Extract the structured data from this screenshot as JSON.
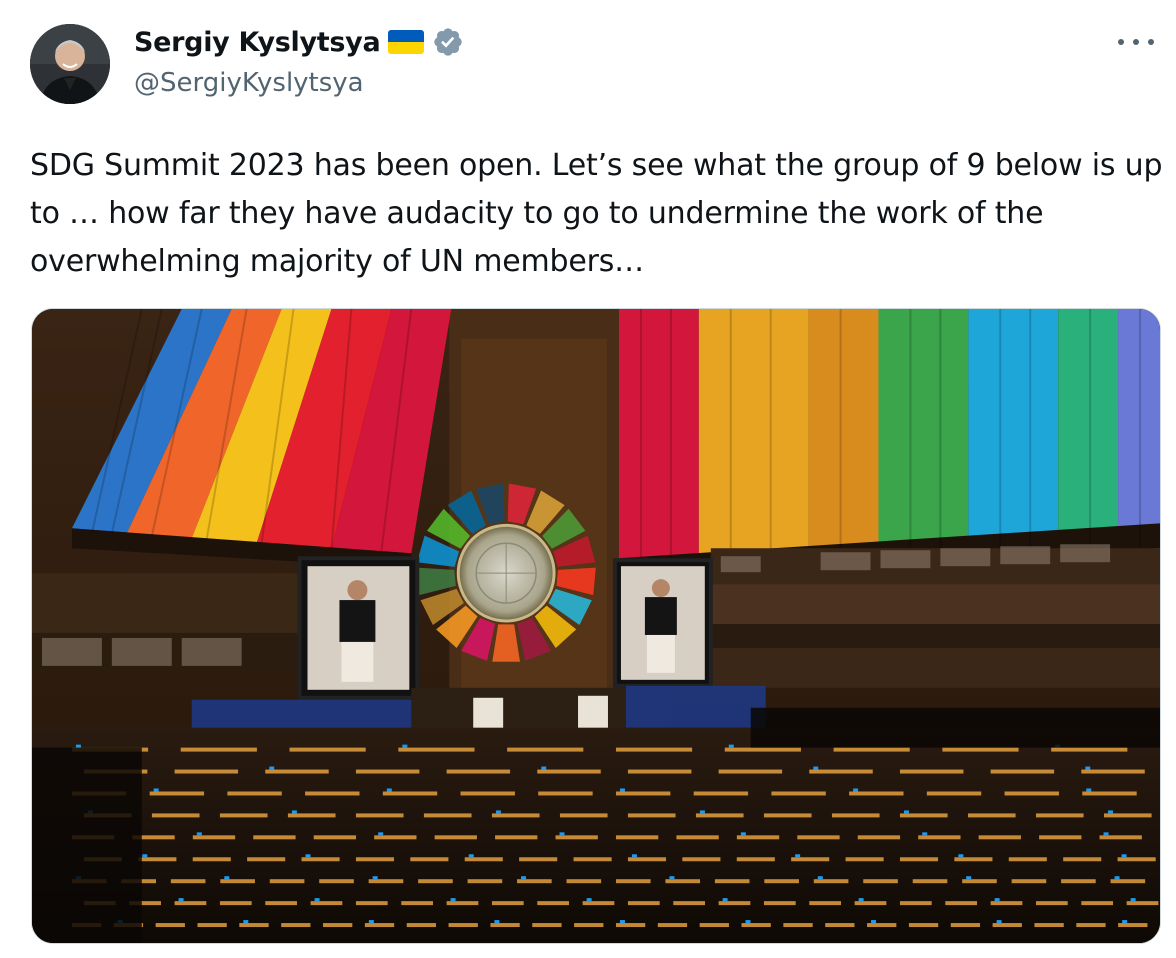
{
  "author": {
    "name": "Sergiy Kyslytsya",
    "handle": "@SergiyKyslytsya",
    "flag_icon": "ukraine-flag-icon",
    "verified_icon": "verified-badge-icon",
    "verified_color": "#829aab"
  },
  "menu": {
    "more_icon": "more-options-icon"
  },
  "post": {
    "text": "SDG Summit 2023 has been open. Let’s see what the group of 9 below is up to … how far they have audacity to go to undermine the work of the overwhelming majority of UN members…"
  },
  "media": {
    "image_label": "",
    "colors": {
      "accent_blue": "#1d9bf0",
      "stage_glow": "#ffb347",
      "sdg_colors": [
        "#e5243b",
        "#dda63a",
        "#4c9f38",
        "#c5192d",
        "#ff3a21",
        "#26bde2",
        "#fcc30b",
        "#a21942",
        "#fd6925",
        "#dd1367",
        "#fd9d24",
        "#bf8b2e",
        "#3f7e44",
        "#0a97d9",
        "#56c02b",
        "#00689d",
        "#19486a"
      ]
    }
  }
}
